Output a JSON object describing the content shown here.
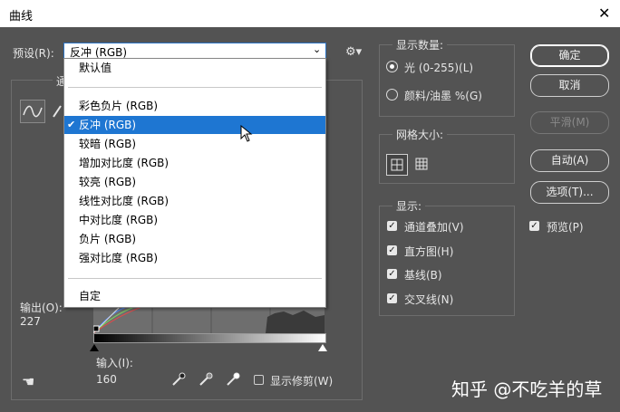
{
  "window": {
    "title": "曲线",
    "close_glyph": "✕"
  },
  "preset": {
    "label": "预设(R):",
    "value": "反冲 (RGB)",
    "menu": {
      "default": "默认值",
      "items": [
        "彩色负片 (RGB)",
        "反冲 (RGB)",
        "较暗 (RGB)",
        "增加对比度 (RGB)",
        "较亮 (RGB)",
        "线性对比度 (RGB)",
        "中对比度 (RGB)",
        "负片 (RGB)",
        "强对比度 (RGB)"
      ],
      "selected_index": 1,
      "custom": "自定"
    }
  },
  "channel_label_partial": "通",
  "display_amount": {
    "title": "显示数量:",
    "light": "光 (0-255)(L)",
    "pigment": "颜料/油墨 %(G)",
    "selected": "light"
  },
  "grid_size": {
    "title": "网格大小:"
  },
  "show": {
    "title": "显示:",
    "options": [
      {
        "label": "通道叠加(V)",
        "checked": true
      },
      {
        "label": "直方图(H)",
        "checked": true
      },
      {
        "label": "基线(B)",
        "checked": true
      },
      {
        "label": "交叉线(N)",
        "checked": true
      }
    ]
  },
  "buttons": {
    "ok": "确定",
    "cancel": "取消",
    "smooth": "平滑(M)",
    "auto": "自动(A)",
    "options": "选项(T)..."
  },
  "preview": {
    "label": "预览(P)",
    "checked": true
  },
  "output": {
    "label": "输出(O):",
    "value": "227"
  },
  "input": {
    "label": "输入(I):",
    "value": "160"
  },
  "show_clipping": {
    "label": "显示修剪(W)",
    "checked": false
  },
  "watermark": "知乎 @不吃羊的草",
  "icons": {
    "gear": "gear-icon",
    "curve_tool": "curve-tool-icon",
    "pencil_tool": "pencil-tool-icon",
    "black_eyedropper": "eyedropper-black-icon",
    "gray_eyedropper": "eyedropper-gray-icon",
    "white_eyedropper": "eyedropper-white-icon",
    "hand_tool": "targeted-adjustment-icon"
  },
  "colors": {
    "background": "#535353",
    "selection": "#1e76d2",
    "menu_bg": "#ffffff"
  }
}
